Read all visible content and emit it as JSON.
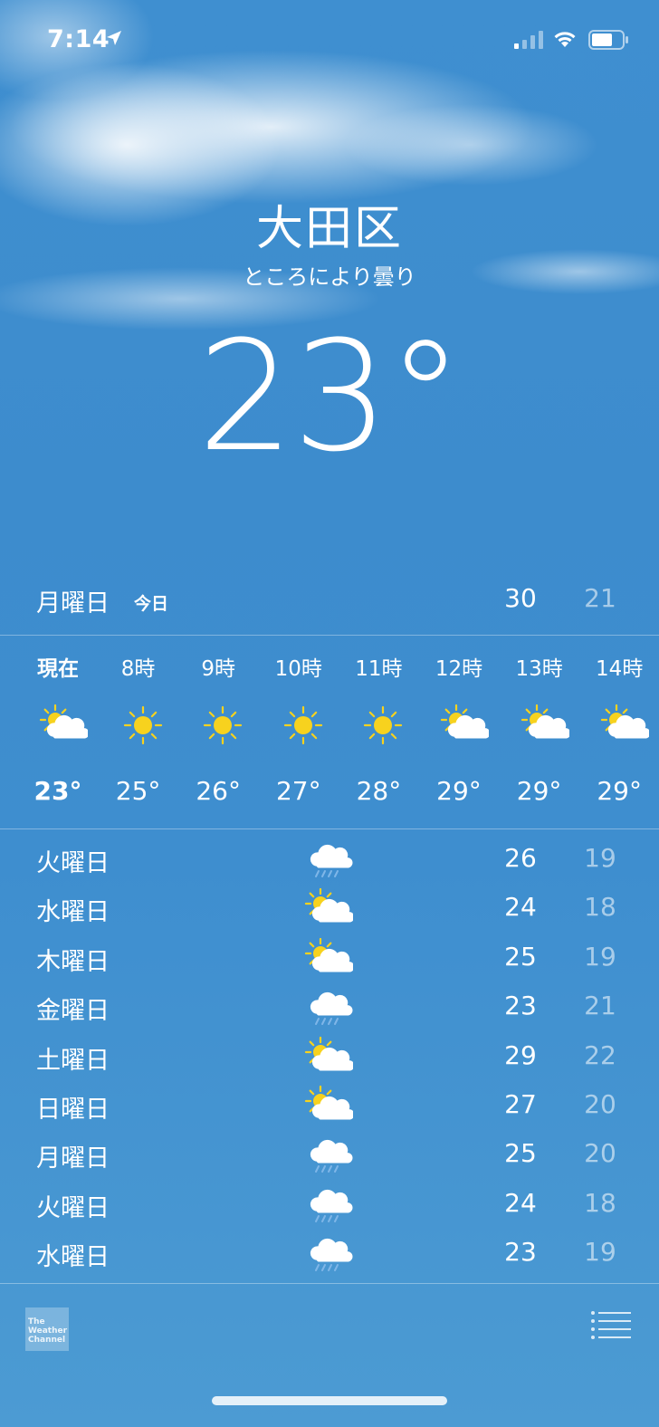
{
  "status_bar": {
    "time": "7:14",
    "location_icon": "location-arrow-icon",
    "signal_icon": "cellular-signal-icon",
    "wifi_icon": "wifi-icon",
    "battery_icon": "battery-icon"
  },
  "location": {
    "city": "大田区",
    "condition": "ところにより曇り",
    "temperature": "23°"
  },
  "today": {
    "day": "月曜日",
    "label": "今日",
    "high": "30",
    "low": "21"
  },
  "hourly": [
    {
      "time": "現在",
      "icon": "partly-cloudy-icon",
      "temp": "23°"
    },
    {
      "time": "8時",
      "icon": "sun-icon",
      "temp": "25°"
    },
    {
      "time": "9時",
      "icon": "sun-icon",
      "temp": "26°"
    },
    {
      "time": "10時",
      "icon": "sun-icon",
      "temp": "27°"
    },
    {
      "time": "11時",
      "icon": "sun-icon",
      "temp": "28°"
    },
    {
      "time": "12時",
      "icon": "partly-cloudy-icon",
      "temp": "29°"
    },
    {
      "time": "13時",
      "icon": "partly-cloudy-icon",
      "temp": "29°"
    },
    {
      "time": "14時",
      "icon": "partly-cloudy-icon",
      "temp": "29°"
    }
  ],
  "daily": [
    {
      "day": "火曜日",
      "icon": "rain-cloud-icon",
      "high": "26",
      "low": "19"
    },
    {
      "day": "水曜日",
      "icon": "partly-cloudy-icon",
      "high": "24",
      "low": "18"
    },
    {
      "day": "木曜日",
      "icon": "partly-cloudy-icon",
      "high": "25",
      "low": "19"
    },
    {
      "day": "金曜日",
      "icon": "rain-cloud-icon",
      "high": "23",
      "low": "21"
    },
    {
      "day": "土曜日",
      "icon": "partly-cloudy-icon",
      "high": "29",
      "low": "22"
    },
    {
      "day": "日曜日",
      "icon": "partly-cloudy-icon",
      "high": "27",
      "low": "20"
    },
    {
      "day": "月曜日",
      "icon": "rain-cloud-icon",
      "high": "25",
      "low": "20"
    },
    {
      "day": "火曜日",
      "icon": "rain-cloud-icon",
      "high": "24",
      "low": "18"
    },
    {
      "day": "水曜日",
      "icon": "rain-cloud-icon",
      "high": "23",
      "low": "19"
    }
  ],
  "footer": {
    "logo_lines": [
      "The",
      "Weather",
      "Channel"
    ],
    "list_icon": "list-icon"
  },
  "colors": {
    "sky": "#3f8fd0",
    "sun": "#f7d21e",
    "low_temp": "#9fc6e8"
  }
}
